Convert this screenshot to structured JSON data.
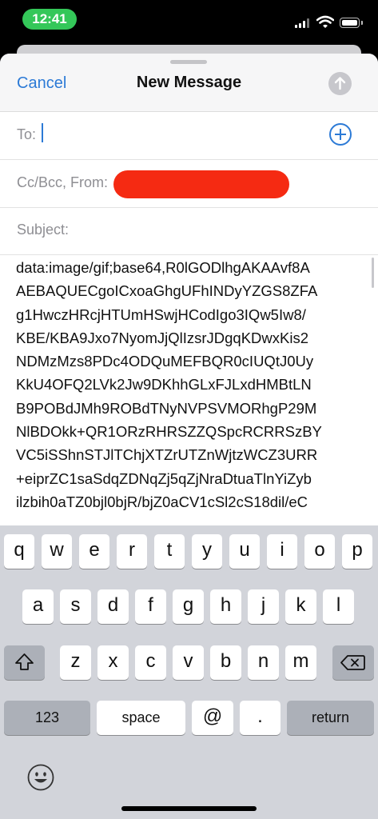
{
  "status_bar": {
    "time": "12:41"
  },
  "nav": {
    "cancel": "Cancel",
    "title": "New Message"
  },
  "fields": {
    "to": "To:",
    "cc_bcc_from": "Cc/Bcc, From:",
    "subject": "Subject:"
  },
  "body_lines": [
    "data:image/gif;base64,R0lGODlhgAKAAvf8A",
    "AEBAQUECgoICxoaGhgUFhINDyYZGS8ZFA",
    "g1HwczHRcjHTUmHSwjHCodIgo3IQw5Iw8/",
    "KBE/KBA9Jxo7NyomJjQlIzsrJDgqKDwxKis2",
    "NDMzMzs8PDc4ODQuMEFBQR0cIUQtJ0Uy",
    "KkU4OFQ2LVk2Jw9DKhhGLxFJLxdHMBtLN",
    "B9POBdJMh9ROBdTNyNVPSVMORhgP29M",
    "NlBDOkk+QR1ORzRHRSZZQSpcRCRRSzBY",
    "VC5iSShnSTJlTChjXTZrUTZnWjtzWCZ3URR",
    "+eiprZC1saSdqZDNqZj5qZjNraDtuaTlnYiZyb",
    "ilzbih0aTZ0bjl0bjR/bjZ0aCV1cSl2cS18dil/eC"
  ],
  "keyboard": {
    "row1": [
      "q",
      "w",
      "e",
      "r",
      "t",
      "y",
      "u",
      "i",
      "o",
      "p"
    ],
    "row2": [
      "a",
      "s",
      "d",
      "f",
      "g",
      "h",
      "j",
      "k",
      "l"
    ],
    "row3": [
      "z",
      "x",
      "c",
      "v",
      "b",
      "n",
      "m"
    ],
    "numbers": "123",
    "space": "space",
    "at": "@",
    "dot": ".",
    "return": "return"
  }
}
